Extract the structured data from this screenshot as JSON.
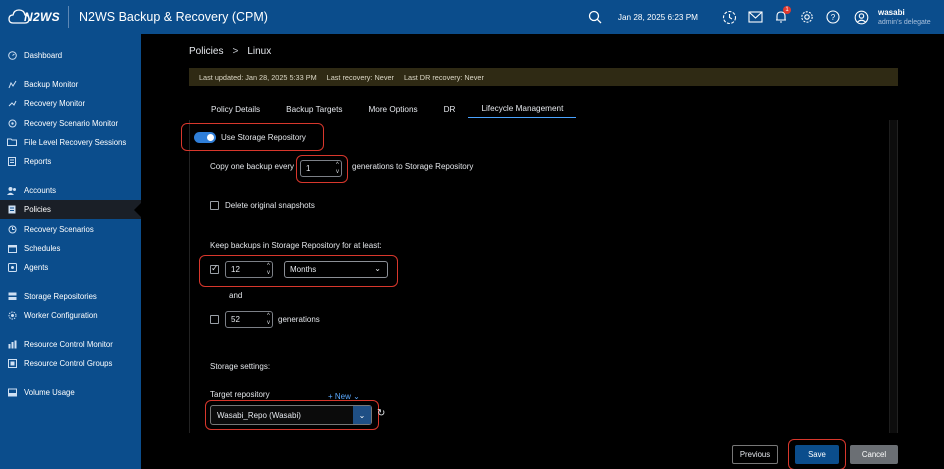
{
  "header": {
    "logo_text": "N2WS",
    "app_title": "N2WS Backup & Recovery (CPM)",
    "datetime": "Jan 28, 2025 6:23 PM",
    "notification_count": "1",
    "user_name": "wasabi",
    "user_role": "admin's delegate"
  },
  "sidebar": {
    "items": [
      {
        "label": "Dashboard",
        "icon": "dashboard-icon"
      },
      {
        "label": "Backup Monitor",
        "icon": "backup-monitor-icon"
      },
      {
        "label": "Recovery Monitor",
        "icon": "recovery-monitor-icon"
      },
      {
        "label": "Recovery Scenario Monitor",
        "icon": "scenario-monitor-icon"
      },
      {
        "label": "File Level Recovery Sessions",
        "icon": "folder-icon"
      },
      {
        "label": "Reports",
        "icon": "reports-icon"
      },
      {
        "label": "Accounts",
        "icon": "accounts-icon"
      },
      {
        "label": "Policies",
        "icon": "policies-icon"
      },
      {
        "label": "Recovery Scenarios",
        "icon": "recovery-scenarios-icon"
      },
      {
        "label": "Schedules",
        "icon": "schedules-icon"
      },
      {
        "label": "Agents",
        "icon": "agents-icon"
      },
      {
        "label": "Storage Repositories",
        "icon": "storage-icon"
      },
      {
        "label": "Worker Configuration",
        "icon": "worker-icon"
      },
      {
        "label": "Resource Control Monitor",
        "icon": "resource-monitor-icon"
      },
      {
        "label": "Resource Control Groups",
        "icon": "resource-groups-icon"
      },
      {
        "label": "Volume Usage",
        "icon": "volume-icon"
      }
    ]
  },
  "breadcrumb": {
    "parent": "Policies",
    "separator": ">",
    "current": "Linux"
  },
  "info_bar": {
    "last_updated": "Last updated: Jan 28, 2025 5:33 PM",
    "last_recovery": "Last recovery: Never",
    "last_dr_recovery": "Last DR recovery: Never"
  },
  "tabs": [
    "Policy Details",
    "Backup Targets",
    "More Options",
    "DR",
    "Lifecycle Management"
  ],
  "form": {
    "use_storage_label": "Use Storage Repository",
    "copy_prefix": "Copy one backup every",
    "copy_value": "1",
    "copy_suffix": "generations to Storage Repository",
    "delete_snapshots_label": "Delete original snapshots",
    "keep_label": "Keep backups in Storage Repository for at least:",
    "keep_value": "12",
    "keep_unit": "Months",
    "and_label": "and",
    "generations_value": "52",
    "generations_label": "generations",
    "storage_settings_label": "Storage settings:",
    "target_repo_label": "Target repository",
    "new_label": "+ New",
    "repo_value": "Wasabi_Repo (Wasabi)"
  },
  "buttons": {
    "previous": "Previous",
    "save": "Save",
    "cancel": "Cancel"
  }
}
